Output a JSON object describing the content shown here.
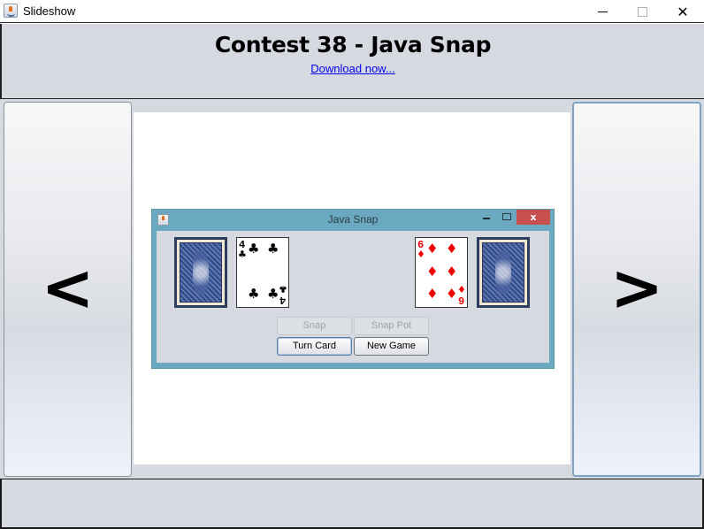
{
  "window": {
    "title": "Slideshow",
    "icon": "java-icon",
    "controls": {
      "minimize": "minimize-icon",
      "maximize": "maximize-icon",
      "close": "✕"
    }
  },
  "header": {
    "title": "Contest 38 - Java Snap",
    "link_label": "Download now..."
  },
  "navigation": {
    "prev_label": "<",
    "next_label": ">"
  },
  "slide": {
    "inner_window": {
      "title": "Java Snap",
      "close_label": "x",
      "cards": [
        {
          "kind": "back",
          "description": "card-back"
        },
        {
          "kind": "face",
          "rank": "4",
          "suit": "♣",
          "color": "#000000"
        },
        {
          "kind": "face",
          "rank": "6",
          "suit": "♦",
          "color": "#ee0000"
        },
        {
          "kind": "back",
          "description": "card-back"
        }
      ],
      "buttons": {
        "snap": {
          "label": "Snap",
          "enabled": false
        },
        "snap_pot": {
          "label": "Snap Pot",
          "enabled": false
        },
        "turn_card": {
          "label": "Turn Card",
          "enabled": true,
          "focused": true
        },
        "new_game": {
          "label": "New Game",
          "enabled": true
        }
      }
    }
  },
  "footer": {}
}
